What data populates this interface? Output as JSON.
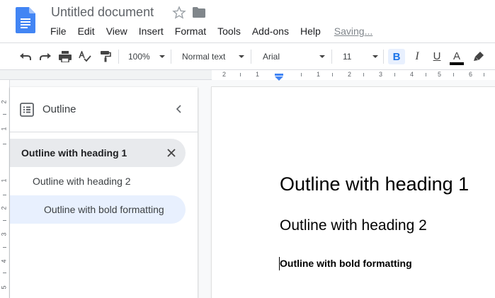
{
  "document": {
    "title": "Untitled document"
  },
  "menu": {
    "items": [
      "File",
      "Edit",
      "View",
      "Insert",
      "Format",
      "Tools",
      "Add-ons",
      "Help"
    ],
    "saving_status": "Saving..."
  },
  "toolbar": {
    "zoom": "100%",
    "style": "Normal text",
    "font": "Arial",
    "font_size": "11",
    "bold": "B",
    "italic": "I",
    "underline": "U",
    "text_color": "A",
    "bold_active": true
  },
  "ruler": {
    "horizontal": [
      "2",
      "1",
      "1",
      "2",
      "3",
      "4",
      "5",
      "6",
      "7"
    ],
    "vertical": [
      "2",
      "1",
      "1",
      "2",
      "3",
      "4",
      "5"
    ]
  },
  "outline": {
    "title": "Outline",
    "items": [
      {
        "label": "Outline with heading 1",
        "level": 1,
        "state": "selected"
      },
      {
        "label": "Outline with heading 2",
        "level": 2,
        "state": "normal"
      },
      {
        "label": "Outline with bold formatting",
        "level": 3,
        "state": "hover"
      }
    ]
  },
  "page": {
    "heading1": "Outline with heading 1",
    "heading2": "Outline with heading 2",
    "bold_text": "Outline with bold formatting"
  },
  "colors": {
    "accent": "#1a73e8",
    "docs_blue": "#4285f4",
    "selected_bg": "#e8eaed",
    "hover_bg": "#e8f0fe"
  },
  "icons": {
    "doc_logo": "google-docs-icon",
    "star": "star-icon",
    "folder": "folder-icon",
    "undo": "undo-icon",
    "redo": "redo-icon",
    "print": "print-icon",
    "spellcheck": "spellcheck-icon",
    "paint_format": "paint-format-icon",
    "highlight": "highlighter-icon",
    "outline": "outline-list-icon",
    "collapse": "chevron-left-icon",
    "remove": "close-icon"
  }
}
